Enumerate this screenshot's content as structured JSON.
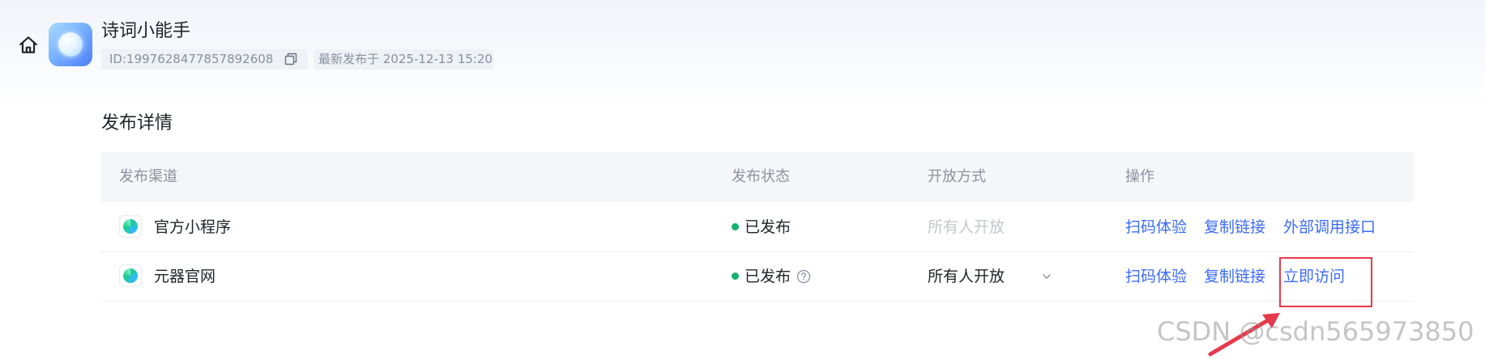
{
  "app": {
    "name": "诗词小能手",
    "id_text": "ID:1997628477857892608",
    "last_published": "最新发布于 2025-12-13 15:20"
  },
  "section": {
    "title": "发布详情"
  },
  "table": {
    "headers": [
      "发布渠道",
      "发布状态",
      "开放方式",
      "操作"
    ],
    "rows": [
      {
        "channel": "官方小程序",
        "status": "已发布",
        "access": "所有人开放",
        "access_disabled": true,
        "has_help": false,
        "has_dropdown": false,
        "actions": [
          "扫码体验",
          "复制链接",
          "外部调用接口"
        ]
      },
      {
        "channel": "元器官网",
        "status": "已发布",
        "access": "所有人开放",
        "access_disabled": false,
        "has_help": true,
        "has_dropdown": true,
        "actions": [
          "扫码体验",
          "复制链接",
          "立即访问"
        ]
      }
    ]
  },
  "watermark": "CSDN @csdn565973850",
  "icons": {
    "home": "home-icon",
    "copy": "copy-icon",
    "help": "question-circle-icon",
    "dropdown": "chevron-down-icon"
  },
  "colors": {
    "link": "#3c6cf5",
    "status_dot": "#16b26e",
    "annotation": "#e6394a",
    "muted": "#8a919f"
  }
}
